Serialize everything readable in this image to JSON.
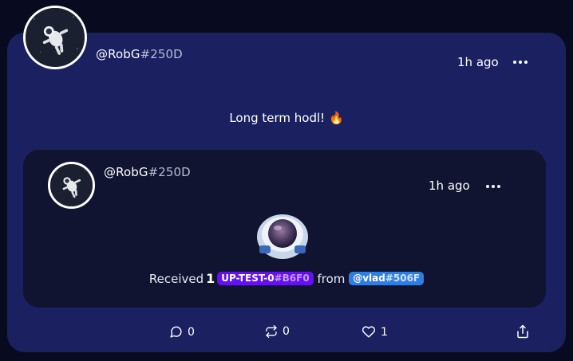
{
  "post": {
    "author": {
      "handle": "@RobG",
      "tag": "#250D"
    },
    "time": "1h ago",
    "text": "Long term hodl! 🔥",
    "embed": {
      "author": {
        "handle": "@RobG",
        "tag": "#250D"
      },
      "time": "1h ago",
      "received_prefix": "Received",
      "quantity": "1",
      "token": {
        "name": "UP-TEST-0",
        "tag": "#B6F0"
      },
      "from_label": "from",
      "sender": {
        "handle": "@vlad",
        "tag": "#506F"
      }
    },
    "actions": {
      "comments": "0",
      "reposts": "0",
      "likes": "1"
    }
  },
  "icons": {
    "more": "more-horizontal-icon",
    "comment": "comment-icon",
    "repost": "repost-icon",
    "like": "heart-icon",
    "share": "share-icon"
  },
  "colors": {
    "background": "#080b1f",
    "card": "#1b2160",
    "embed": "#101431",
    "token_pill": "#6411f0",
    "user_pill": "#2f7fe2"
  }
}
